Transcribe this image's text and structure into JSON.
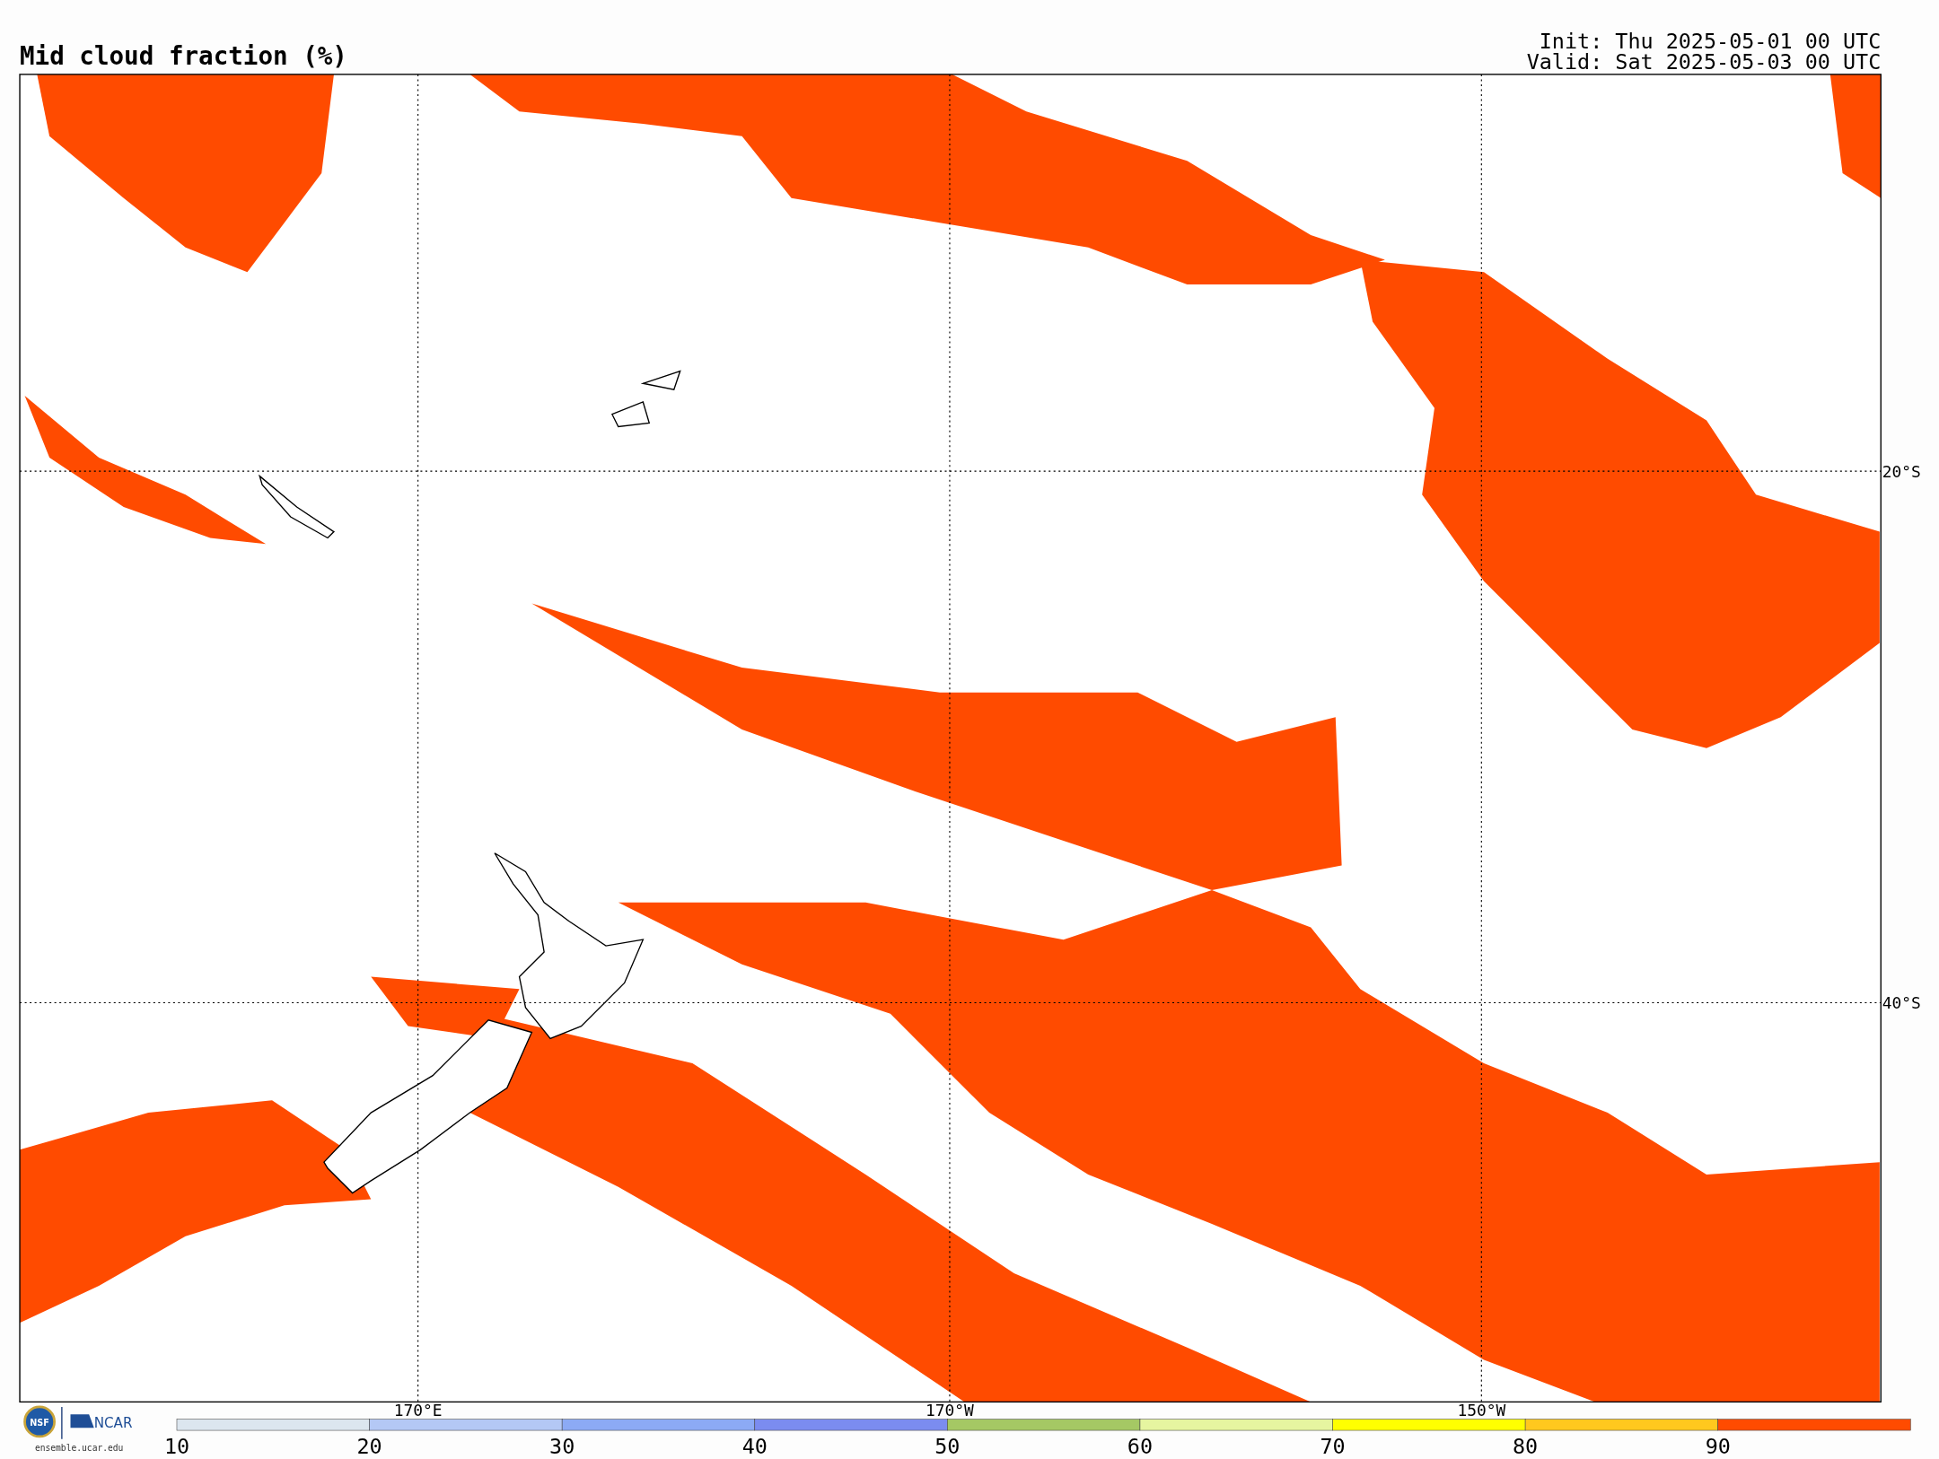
{
  "title": "Mid cloud fraction (%)",
  "init": "Init: Thu 2025-05-01 00 UTC",
  "valid": "Valid: Sat 2025-05-03 00 UTC",
  "map": {
    "latitude_labels": [
      "20°S",
      "40°S"
    ],
    "longitude_labels": [
      "170°E",
      "170°W",
      "150°W"
    ]
  },
  "colorbar": {
    "ticks": [
      "10",
      "20",
      "30",
      "40",
      "50",
      "60",
      "70",
      "80",
      "90"
    ],
    "bins": [
      {
        "color": "#dce6ef"
      },
      {
        "color": "#b4c8f5"
      },
      {
        "color": "#8caaf5"
      },
      {
        "color": "#7b8cf0"
      },
      {
        "color": "#a5c864"
      },
      {
        "color": "#e6f5a0"
      },
      {
        "color": "#ffff00"
      },
      {
        "color": "#ffc81e"
      },
      {
        "color": "#ff4b00"
      }
    ]
  },
  "footer": {
    "nsf_logo": "NSF",
    "ncar_logo": "NCAR",
    "site": "ensemble.ucar.edu"
  }
}
